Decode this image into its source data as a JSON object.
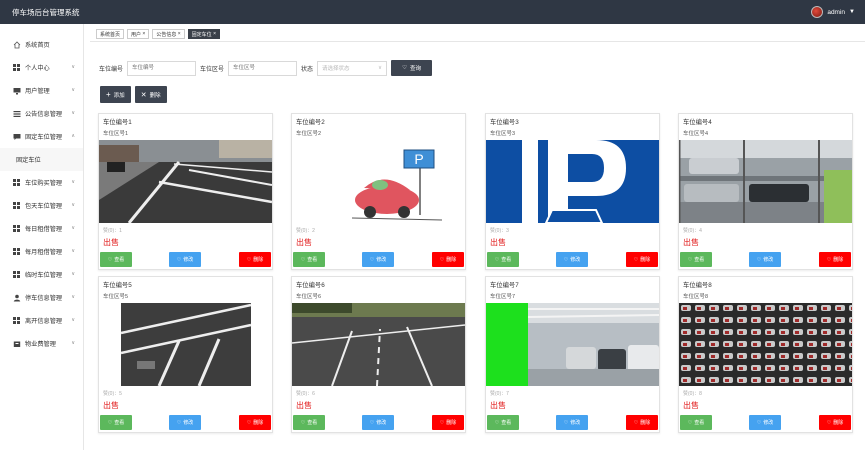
{
  "app": {
    "title": "停车场后台管理系统",
    "user": "admin"
  },
  "sidebar": {
    "items": [
      {
        "label": "系统首页",
        "icon": "home-icon"
      },
      {
        "label": "个人中心",
        "icon": "grid-icon"
      },
      {
        "label": "用户管理",
        "icon": "monitor-icon"
      },
      {
        "label": "公告信息管理",
        "icon": "list-icon"
      },
      {
        "label": "固定车位管理",
        "icon": "chat-icon"
      },
      {
        "label": "固定车位",
        "icon": ""
      },
      {
        "label": "车位购买管理",
        "icon": "grid-icon"
      },
      {
        "label": "包天车位管理",
        "icon": "grid-icon"
      },
      {
        "label": "每日租借管理",
        "icon": "grid-icon"
      },
      {
        "label": "每月租借管理",
        "icon": "grid-icon"
      },
      {
        "label": "临时车位管理",
        "icon": "grid-icon"
      },
      {
        "label": "停车信息管理",
        "icon": "user-icon"
      },
      {
        "label": "离开信息管理",
        "icon": "grid-icon"
      },
      {
        "label": "物业费管理",
        "icon": "box-icon"
      }
    ]
  },
  "tabs": [
    "系统首页",
    "用户",
    "公告信息",
    "固定车位"
  ],
  "search": {
    "label_no": "车位编号",
    "placeholder_no": "车位编号",
    "label_area": "车位区号",
    "placeholder_area": "车位区号",
    "label_status": "状态",
    "placeholder_status": "请选择状态",
    "query": "查询"
  },
  "toolbar": {
    "add": "添加",
    "delete": "删除"
  },
  "cards": [
    {
      "title": "车位编号1",
      "area": "车位区号1",
      "likes": "赞(0)：1",
      "sale": "出售",
      "image": "street-parking"
    },
    {
      "title": "车位编号2",
      "area": "车位区号2",
      "likes": "赞(0)：2",
      "sale": "出售",
      "image": "cartoon-car"
    },
    {
      "title": "车位编号3",
      "area": "车位区号3",
      "likes": "赞(0)：3",
      "sale": "出售",
      "image": "parking-sign"
    },
    {
      "title": "车位编号4",
      "area": "车位区号4",
      "likes": "赞(0)：4",
      "sale": "出售",
      "image": "stacked-parking"
    },
    {
      "title": "车位编号5",
      "area": "车位区号5",
      "likes": "赞(0)：5",
      "sale": "出售",
      "image": "asphalt-lines"
    },
    {
      "title": "车位编号6",
      "area": "车位区号6",
      "likes": "赞(0)：6",
      "sale": "出售",
      "image": "outdoor-lot"
    },
    {
      "title": "车位编号7",
      "area": "车位区号7",
      "likes": "赞(0)：7",
      "sale": "出售",
      "image": "garage"
    },
    {
      "title": "车位编号8",
      "area": "车位区号8",
      "likes": "赞(0)：8",
      "sale": "出售",
      "image": "tower-parking"
    }
  ],
  "card_buttons": {
    "view": "查看",
    "edit": "修改",
    "del": "删除"
  },
  "colors": {
    "topbar": "#2f3744",
    "view": "#5cb85c",
    "edit": "#45a2f0",
    "del": "#ff0000",
    "sale": "#e21d1d"
  }
}
